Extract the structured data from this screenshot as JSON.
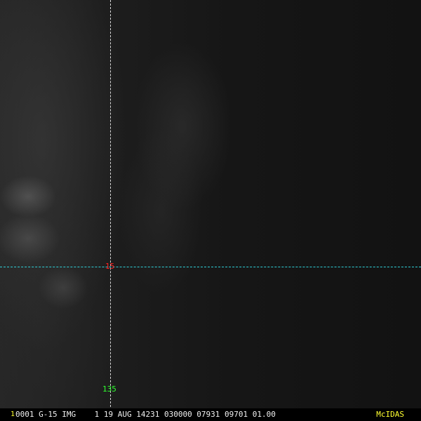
{
  "overlay": {
    "lat_label": "15",
    "lon_label": "135",
    "colors": {
      "lat_line": "#2fd0d8",
      "lon_line": "#d8d8d8",
      "lat_text": "#ff2020",
      "lon_text": "#30ff30"
    }
  },
  "status_bar": {
    "frame_number": "1",
    "info": "0001 G-15 IMG    1 19 AUG 14231 030000 07931 09701 01.00",
    "brand": "McIDAS"
  }
}
